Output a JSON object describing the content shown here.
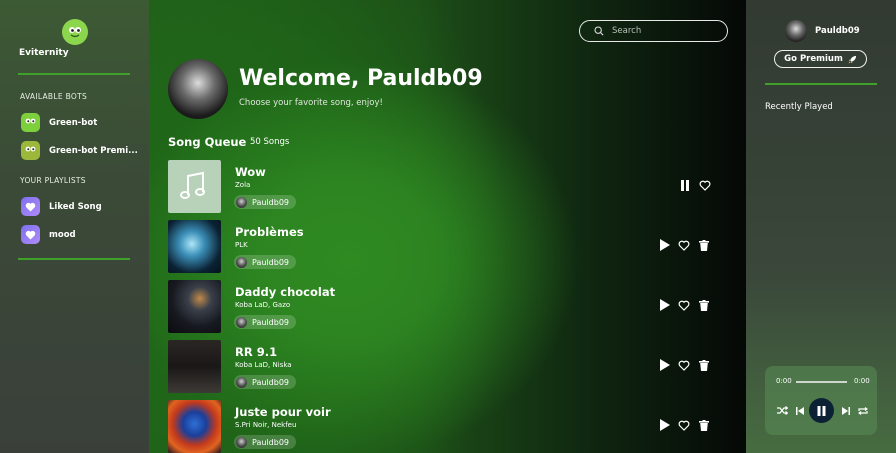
{
  "sidebar": {
    "brand": "Eviternity",
    "bots_title": "AVAILABLE BOTS",
    "bots": [
      {
        "label": "Green-bot"
      },
      {
        "label": "Green-bot Premi..."
      }
    ],
    "playlists_title": "YOUR PLAYLISTS",
    "playlists": [
      {
        "label": "Liked Song"
      },
      {
        "label": "mood"
      }
    ]
  },
  "search": {
    "placeholder": "Search"
  },
  "welcome": {
    "title": "Welcome, Pauldb09",
    "subtitle": "Choose your favorite song, enjoy!"
  },
  "queue": {
    "title": "Song Queue",
    "count": "50 Songs",
    "songs": [
      {
        "title": "Wow",
        "artist": "Zola",
        "user": "Pauldb09",
        "playing": true
      },
      {
        "title": "Problèmes",
        "artist": "PLK",
        "user": "Pauldb09",
        "playing": false
      },
      {
        "title": "Daddy chocolat",
        "artist": "Koba LaD, Gazo",
        "user": "Pauldb09",
        "playing": false
      },
      {
        "title": "RR 9.1",
        "artist": "Koba LaD, Niska",
        "user": "Pauldb09",
        "playing": false
      },
      {
        "title": "Juste pour voir",
        "artist": "S.Pri Noir, Nekfeu",
        "user": "Pauldb09",
        "playing": false
      }
    ]
  },
  "profile": {
    "username": "Pauldb09",
    "premium_label": "Go Premium"
  },
  "recent": {
    "title": "Recently Played"
  },
  "player": {
    "time_current": "0:00",
    "time_total": "0:00"
  },
  "colors": {
    "accent": "#3fa12a",
    "bot_icon": "#7dcf3c",
    "playlist_icon": "#8f7cf3",
    "player_pause_bg": "#0d2134"
  }
}
